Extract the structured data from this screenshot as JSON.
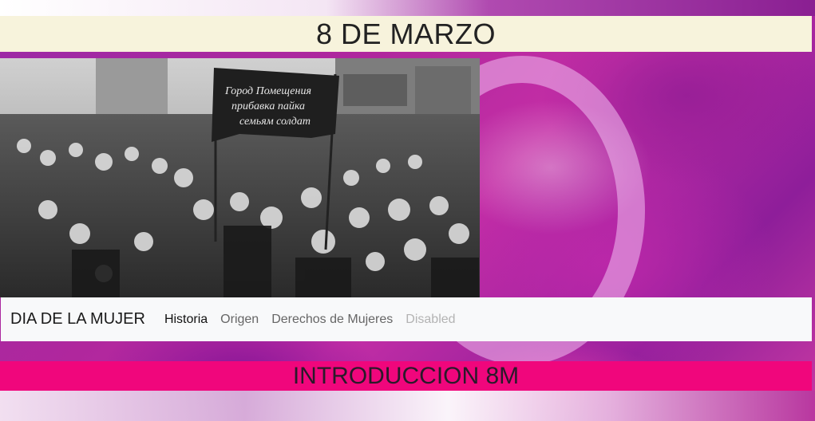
{
  "header": {
    "title": "8 DE MARZO"
  },
  "hero_image": {
    "banner_text": "Город Помещения прибавка пайка семьям солдат"
  },
  "navbar": {
    "brand": "DIA DE LA MUJER",
    "links": [
      {
        "label": "Historia",
        "state": "active"
      },
      {
        "label": "Origen",
        "state": "normal"
      },
      {
        "label": "Derechos de Mujeres",
        "state": "normal"
      },
      {
        "label": "Disabled",
        "state": "disabled"
      }
    ]
  },
  "section": {
    "title": "INTRODUCCION 8M"
  },
  "colors": {
    "title_bar_bg": "#f7f3dc",
    "section_bar_bg": "#f0067c",
    "navbar_bg": "#f8f9fa",
    "background_purple": "#9a2aa6"
  }
}
